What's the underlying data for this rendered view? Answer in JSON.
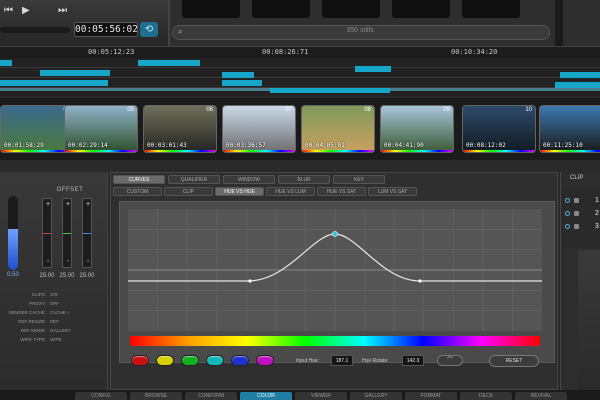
{
  "transport": {
    "prev_icon": "⏮",
    "play_icon": "▶",
    "next_icon": "⏭",
    "timecode": "00:05:56:02",
    "loop_icon": "⟲"
  },
  "stills": {
    "search_icon": "⌕",
    "label": "350 stills"
  },
  "ruler": {
    "marks": [
      "00:05:12:23",
      "00:08:26:71",
      "00:10:34:20"
    ]
  },
  "thumbnails": [
    {
      "num": "04",
      "tc": "00:01:58:29",
      "colors": [
        "#3b6a8f",
        "#4b7a3a"
      ]
    },
    {
      "num": "05",
      "tc": "00:02:29:14",
      "colors": [
        "#8fb2c9",
        "#2c4f2a"
      ]
    },
    {
      "num": "06",
      "tc": "00:03:01:43",
      "colors": [
        "#6f6f5a",
        "#242424"
      ]
    },
    {
      "num": "07",
      "tc": "00:03:36:57",
      "colors": [
        "#c9d8e8",
        "#6d6d6d"
      ]
    },
    {
      "num": "08",
      "tc": "00:04:05:01",
      "colors": [
        "#7f9a5a",
        "#c9a060"
      ]
    },
    {
      "num": "09",
      "tc": "00:04:41:90",
      "colors": [
        "#a8c4da",
        "#3a5a35"
      ]
    },
    {
      "num": "10",
      "tc": "00:08:12:02",
      "colors": [
        "#2d4a6a",
        "#111a22"
      ]
    },
    {
      "num": "11",
      "tc": "00:11:25:10",
      "colors": [
        "#3d7ab0",
        "#1a1a1a"
      ]
    }
  ],
  "left_panel": {
    "offset_label": "OFFSET",
    "master_value": "0.50",
    "master_level": 0.55,
    "plus": "+",
    "minus": "-",
    "offset_values": [
      "25.00",
      "25.00",
      "25.00"
    ],
    "info": [
      {
        "k": "CLIPS:",
        "v": "378"
      },
      {
        "k": "PROXY:",
        "v": "OFF"
      },
      {
        "k": "RENDER CACHE:",
        "v": "CACHE +"
      },
      {
        "k": "REF RESIZE:",
        "v": "REF"
      },
      {
        "k": "REF MODE:",
        "v": "GALLERY"
      },
      {
        "k": "WIPE TYPE:",
        "v": "WIPE"
      }
    ]
  },
  "tabs_row1": [
    "CURVES",
    "QUALIFIER",
    "WINDOW",
    "BLUR",
    "KEY"
  ],
  "tabs_row2": [
    "CUSTOM",
    "CLIP",
    "HUE VS HUE",
    "HUE VS LUM",
    "HUE VS SAT",
    "LUM VS SAT"
  ],
  "controls": {
    "input_hue_label": "Input Hue:",
    "input_hue_value": "187.1",
    "hue_rotate_label": "Hue Rotate:",
    "hue_rotate_value": "142.3",
    "curve_icon": "⌒",
    "reset_label": "RESET"
  },
  "swatches": [
    "#c81010",
    "#d8d000",
    "#10b020",
    "#10b8b8",
    "#2030d0",
    "#c010c0"
  ],
  "right_panel": {
    "clip_label": "CLIP",
    "rows": [
      "1",
      "2",
      "3"
    ]
  },
  "bottom_nav": [
    "CONFIG",
    "BROWSE",
    "CONFORM",
    "COLOR",
    "VIEWER",
    "GALLERY",
    "FORMAT",
    "DECK",
    "REVIVAL"
  ],
  "bottom_nav_active": "COLOR"
}
